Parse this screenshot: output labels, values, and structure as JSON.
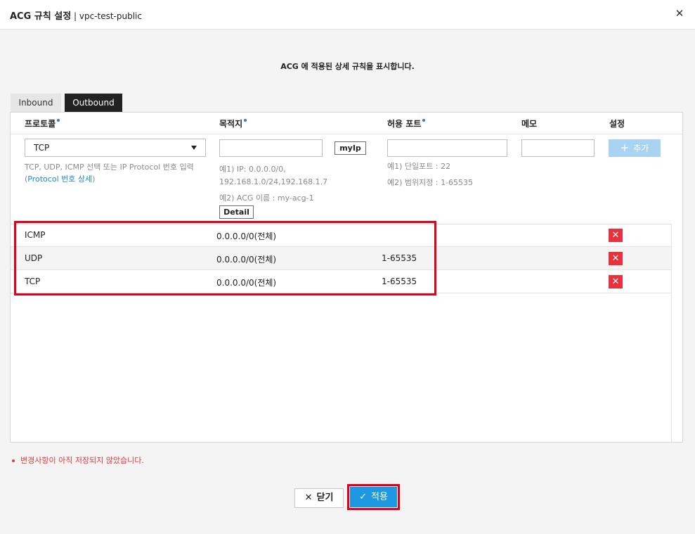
{
  "header": {
    "title_strong": "ACG 규칙 설정",
    "title_sub": " | vpc-test-public",
    "close_glyph": "✕"
  },
  "description": "ACG 에 적용된 상세 규칙을 표시합니다.",
  "tabs": [
    {
      "label": "Inbound",
      "active": false
    },
    {
      "label": "Outbound",
      "active": true
    }
  ],
  "columns": {
    "protocol": "프로토콜",
    "destination": "목적지",
    "port": "허용 포트",
    "memo": "메모",
    "setting": "설정"
  },
  "form": {
    "protocol_selected": "TCP",
    "protocol_help": "TCP, UDP, ICMP 선택 또는 IP Protocol 번호 입력",
    "protocol_help_prefix": "(",
    "protocol_help_link": "Protocol 번호 상세",
    "protocol_help_suffix": ")",
    "destination_value": "",
    "myip_label": "myIp",
    "dest_example1_line1": "예1) IP: 0.0.0.0/0,",
    "dest_example1_line2": "192.168.1.0/24,192.168.1.7",
    "dest_example2": "예2) ACG 이름 : my-acg-1",
    "detail_label": "Detail",
    "port_value": "",
    "port_example1": "예1) 단일포트 : 22",
    "port_example2": "예2) 범위지정 : 1-65535",
    "memo_value": "",
    "add_label": "추가"
  },
  "rules": [
    {
      "protocol": "ICMP",
      "destination": "0.0.0.0/0(전체)",
      "port": ""
    },
    {
      "protocol": "UDP",
      "destination": "0.0.0.0/0(전체)",
      "port": "1-65535"
    },
    {
      "protocol": "TCP",
      "destination": "0.0.0.0/0(전체)",
      "port": "1-65535"
    }
  ],
  "delete_glyph": "✕",
  "warning": "변경사항이 아직 저장되지 않았습니다.",
  "footer": {
    "close_label": "닫기",
    "apply_label": "적용"
  },
  "colors": {
    "accent": "#1d98e3",
    "danger": "#e8313c",
    "highlight": "#e0001b"
  }
}
